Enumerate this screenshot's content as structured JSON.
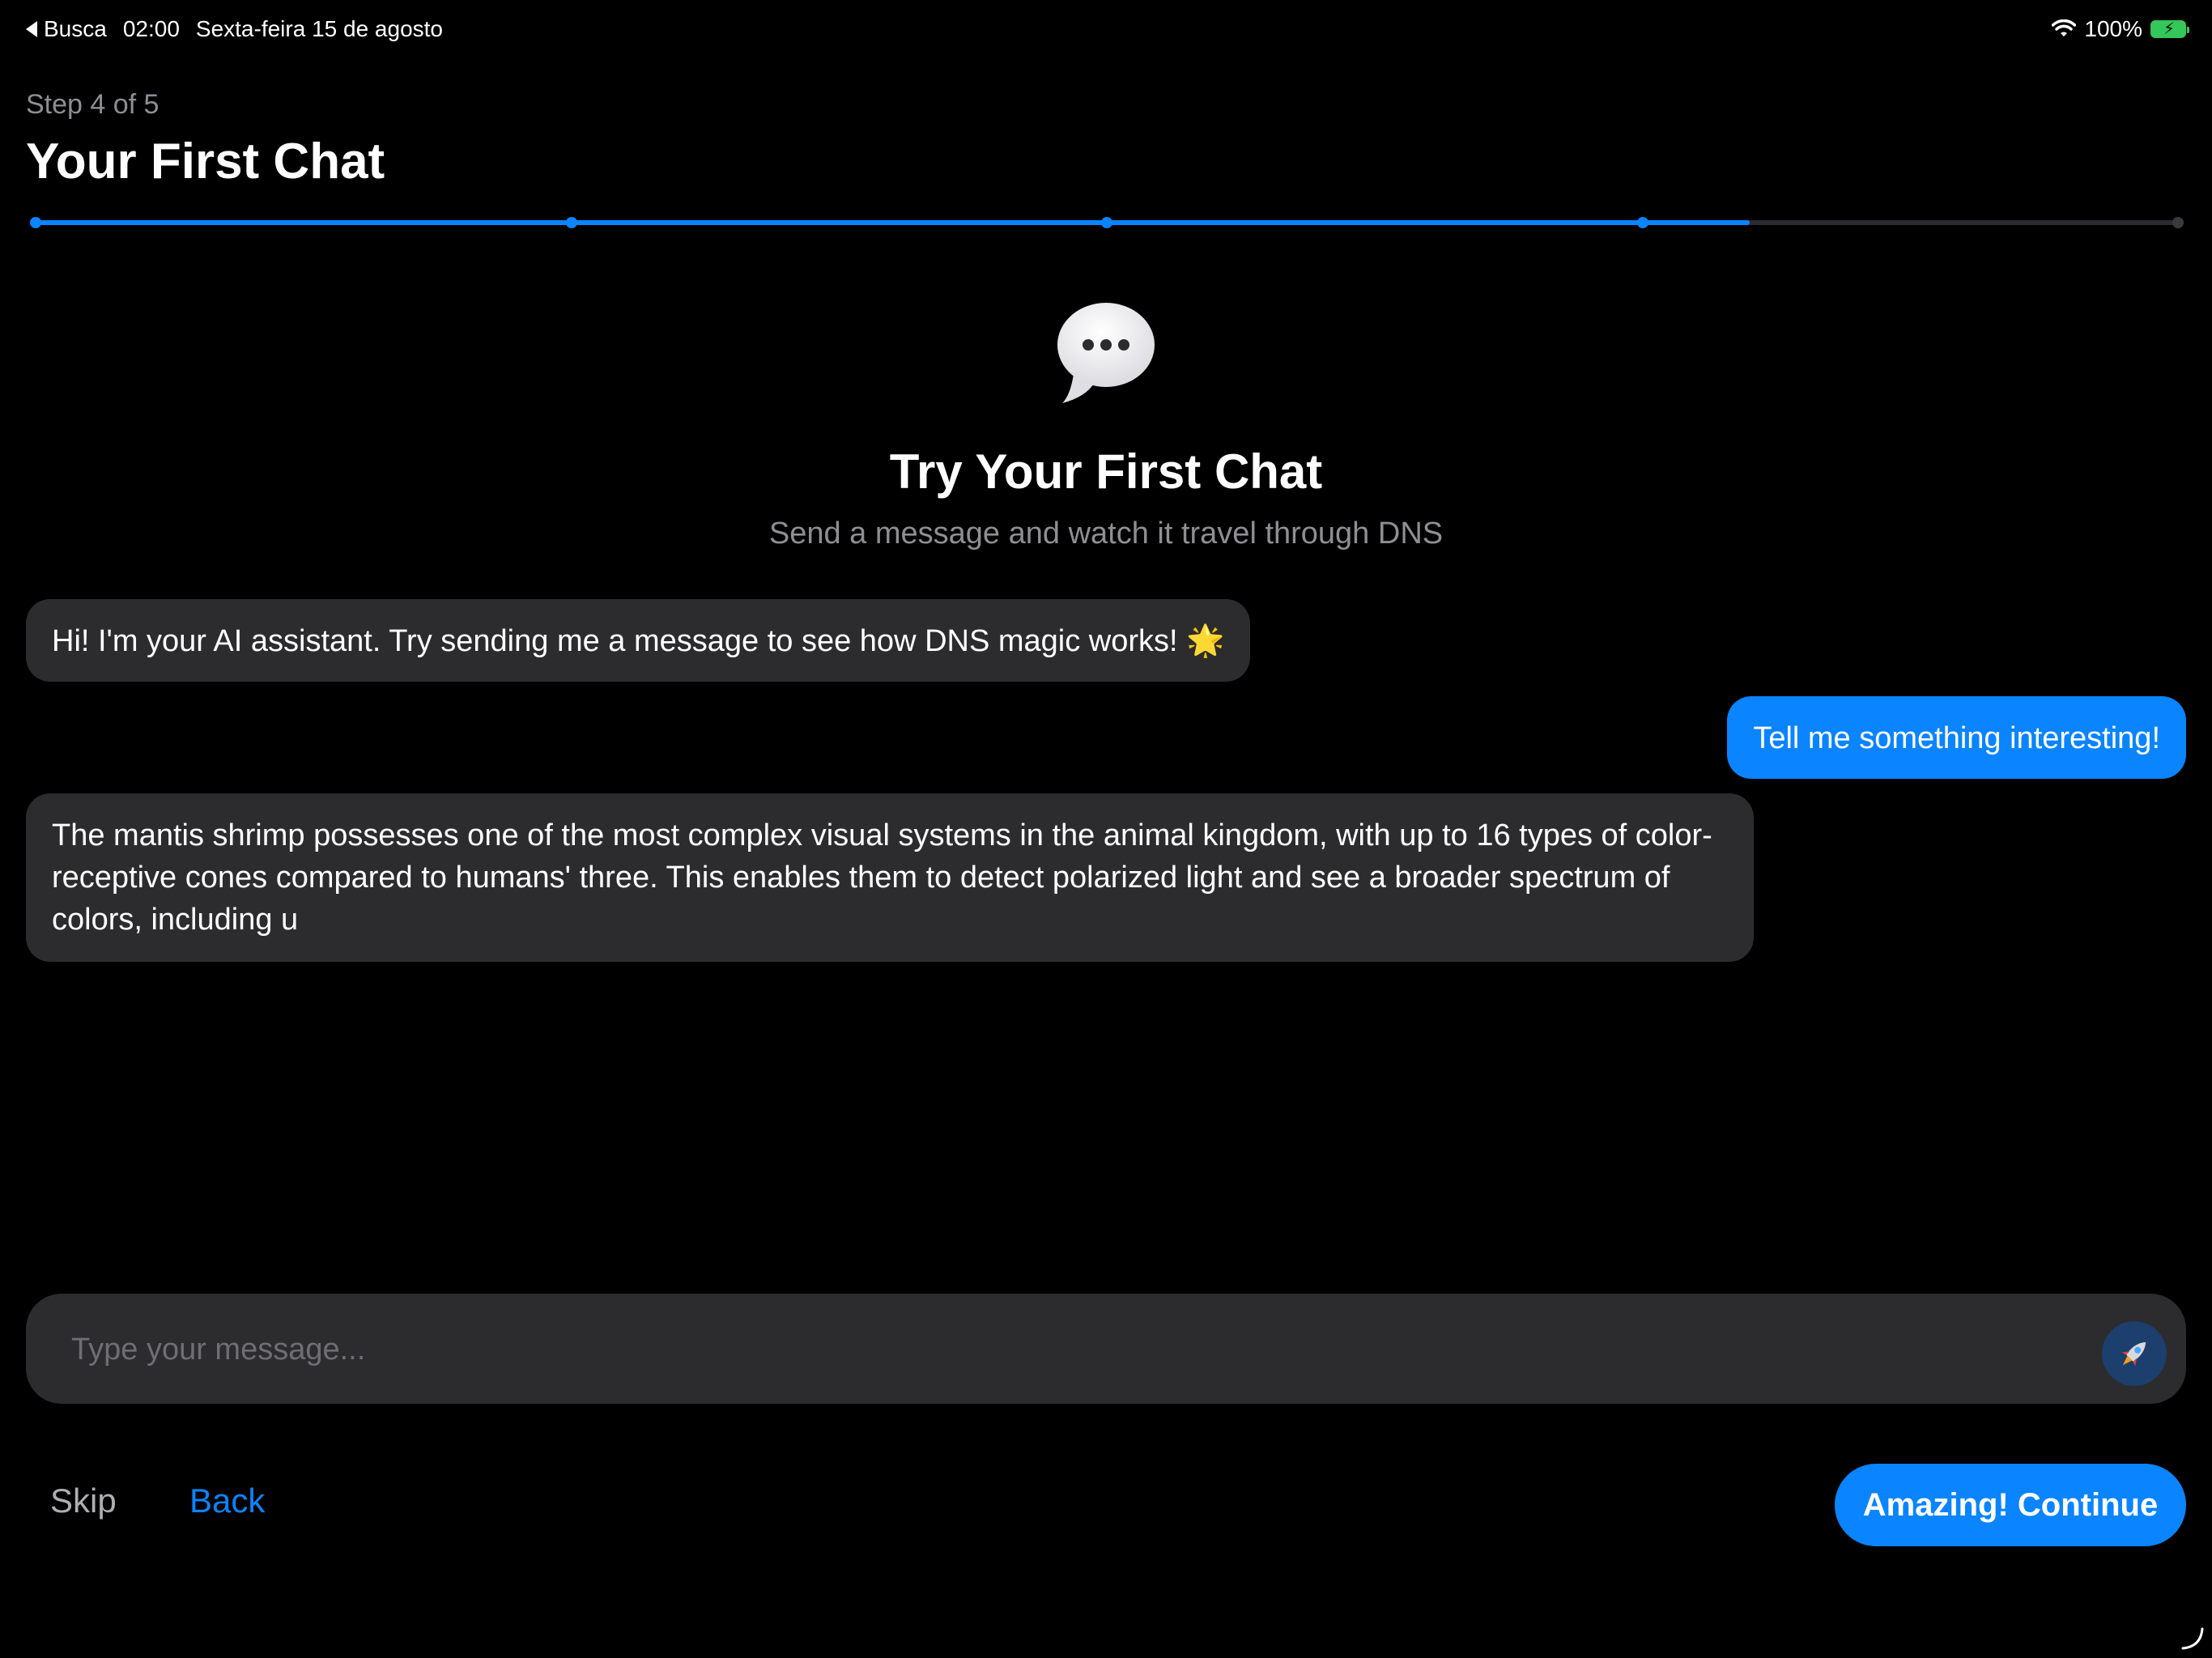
{
  "status_bar": {
    "back_app": "Busca",
    "time": "02:00",
    "date": "Sexta-feira 15 de agosto",
    "battery_percent": "100%",
    "battery_level": 1.0,
    "battery_color": "#34c759"
  },
  "header": {
    "step_label": "Step 4 of 5",
    "title": "Your First Chat"
  },
  "progress": {
    "current_step": 4,
    "total_steps": 5,
    "fill_fraction": 0.8,
    "accent_color": "#0a84ff",
    "track_color": "#2c2c2e"
  },
  "hero": {
    "icon": "speech-bubble-icon",
    "title": "Try Your First Chat",
    "subtitle": "Send a message and watch it travel through DNS"
  },
  "messages": [
    {
      "role": "assistant",
      "text": "Hi! I'm your AI assistant. Try sending me a message to see how DNS magic works! 🌟"
    },
    {
      "role": "user",
      "text": "Tell me something interesting!"
    },
    {
      "role": "assistant",
      "text": "The mantis shrimp possesses one of the most complex visual systems in the animal kingdom, with up to 16 types of color-receptive cones compared to humans' three. This enables them to detect polarized light and see a broader spectrum of colors, including u"
    }
  ],
  "composer": {
    "placeholder": "Type your message...",
    "value": "",
    "send_icon": "rocket-icon"
  },
  "footer": {
    "skip_label": "Skip",
    "back_label": "Back",
    "continue_label": "Amazing! Continue"
  }
}
